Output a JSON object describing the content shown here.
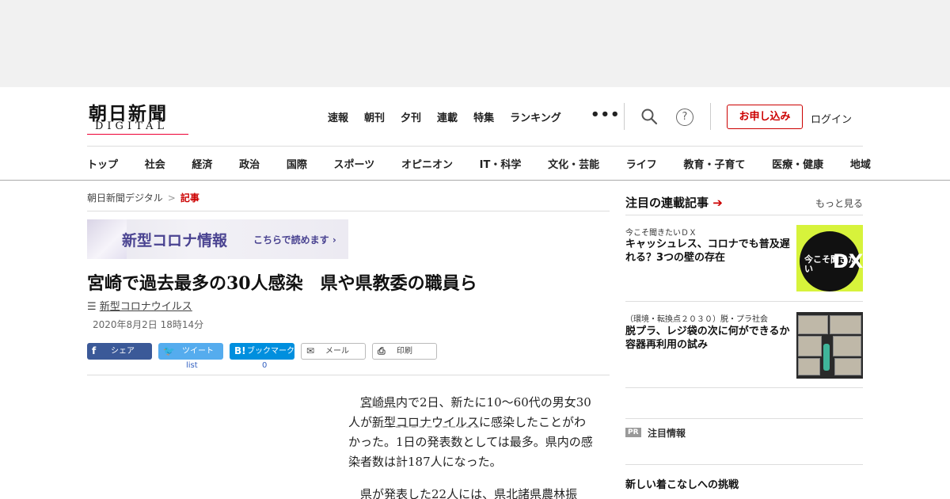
{
  "header": {
    "logo_main": "朝日新聞",
    "logo_sub": "DIGITAL",
    "top_nav": [
      "速報",
      "朝刊",
      "夕刊",
      "連載",
      "特集",
      "ランキング"
    ],
    "more": "•••",
    "apply_label": "お申し込み",
    "login_label": "ログイン"
  },
  "categories": [
    "トップ",
    "社会",
    "経済",
    "政治",
    "国際",
    "スポーツ",
    "オピニオン",
    "IT・科学",
    "文化・芸能",
    "ライフ",
    "教育・子育て",
    "医療・健康",
    "地域"
  ],
  "breadcrumb": {
    "home": "朝日新聞デジタル",
    "separator": ">",
    "current": "記事"
  },
  "banner": {
    "title": "新型コロナ情報",
    "link": "こちらで読めます ›"
  },
  "article": {
    "headline": "宮崎で過去最多の30人感染　県や県教委の職員ら",
    "tag": "新型コロナウイルス",
    "date": "2020年8月2日 18時14分",
    "para1_a": "宮崎県",
    "para1_b": "内で2日、新たに10～60代の男女30人が",
    "para1_c": "新型コロナウイルス",
    "para1_d": "に感染したことがわかった。1日の発表数としては最多。県内の感染者数は計187人になった。",
    "para2": "県が発表した22人には、県北諸県農林振"
  },
  "share": {
    "facebook": "シェア",
    "twitter": "ツイート",
    "hatena": "ブックマーク",
    "mail": "メール",
    "print": "印刷",
    "twitter_count": "list",
    "hatena_count": "0"
  },
  "sidebar": {
    "title": "注目の連載記事",
    "more": "もっと見る",
    "items": [
      {
        "kicker": "今こそ聞きたいＤＸ",
        "title": "キャッシュレス、コロナでも普及遅れる？3つの壁の存在",
        "thumb_text_small": "今こそ聞きたい",
        "thumb_text_big": "DX"
      },
      {
        "kicker": "（環境・転換点２０３０）脱・プラ社会",
        "title": "脱プラ、レジ袋の次に何ができるか　容器再利用の試み"
      }
    ],
    "pr_badge": "PR",
    "pr_label": "注目情報",
    "bottom_title": "新しい着こなしへの挑戦"
  },
  "colors": {
    "accent_red": "#cc0000",
    "facebook": "#3b5998",
    "twitter": "#55acee",
    "hatena": "#008fde",
    "banner_text": "#4a4391"
  }
}
